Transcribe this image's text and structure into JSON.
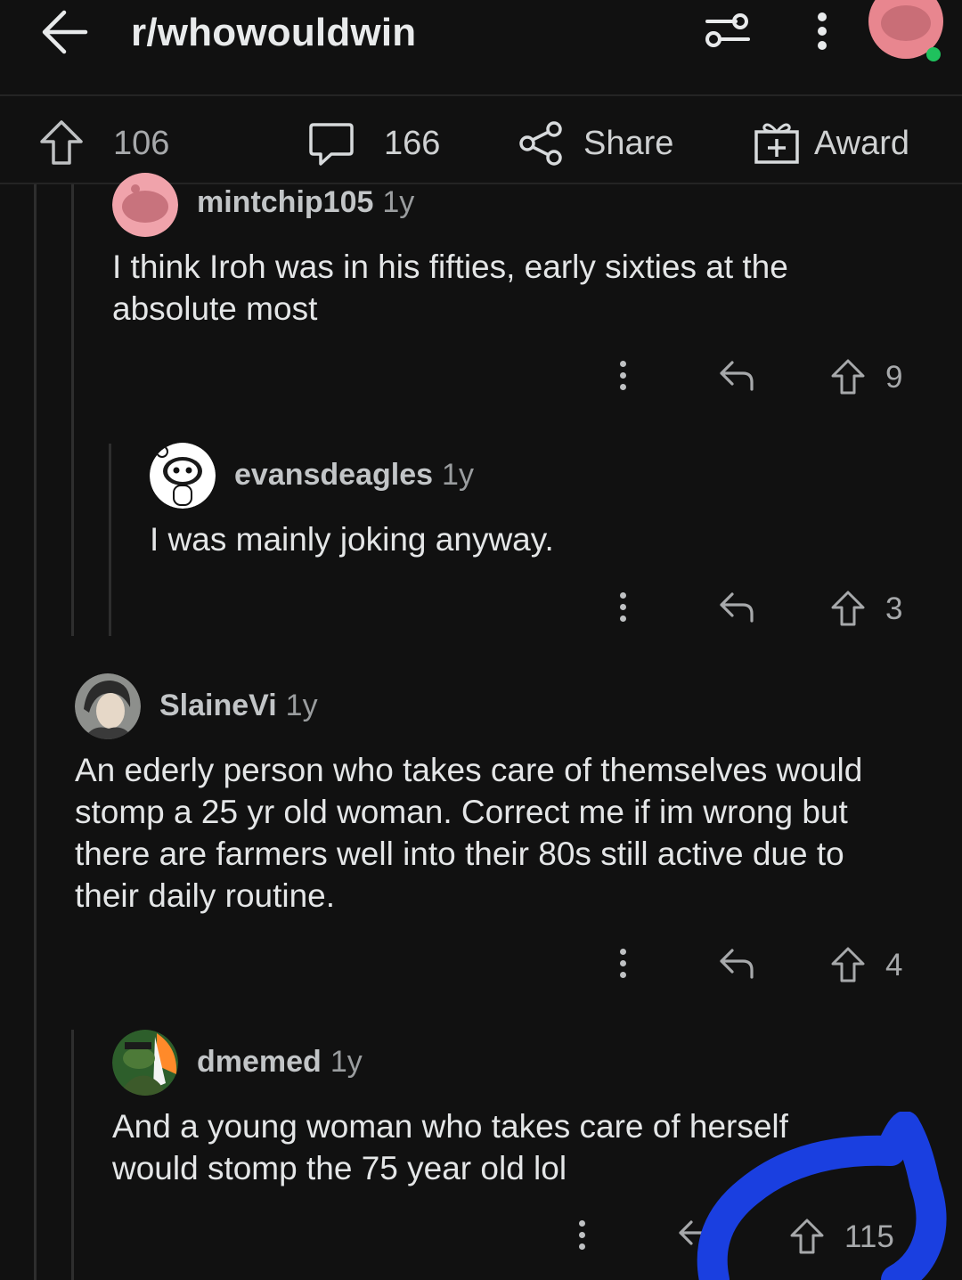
{
  "header": {
    "subreddit": "r/whowouldwin"
  },
  "post_actions": {
    "upvotes": "106",
    "comments": "166",
    "share_label": "Share",
    "award_label": "Award"
  },
  "comments": [
    {
      "username": "mintchip105",
      "age": "1y",
      "text": "I think Iroh was in his fifties, early sixties at the absolute most",
      "score": "9"
    },
    {
      "username": "evansdeagles",
      "age": "1y",
      "text": "I was mainly joking anyway.",
      "score": "3"
    },
    {
      "username": "SlaineVi",
      "age": "1y",
      "text": "An ederly person who takes care of themselves would stomp a 25 yr old woman. Correct me if im wrong but there are farmers well into their 80s still active due to their daily routine.",
      "score": "4"
    },
    {
      "username": "dmemed",
      "age": "1y",
      "text": "And a young woman who takes care of herself would stomp the 75 year old lol",
      "score": "115"
    }
  ],
  "colors": {
    "background": "#111111",
    "annotation": "#1a3fe0",
    "online_dot": "#1fc15d"
  }
}
